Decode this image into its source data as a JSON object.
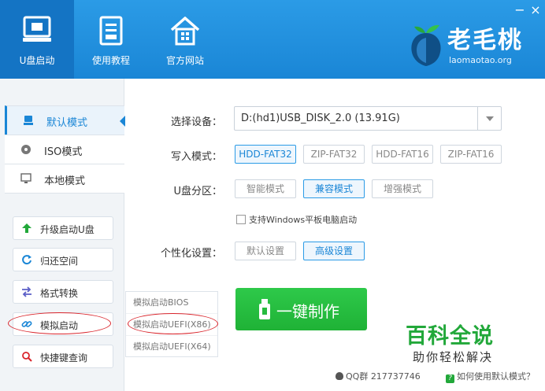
{
  "header": {
    "nav": [
      {
        "label": "U盘启动"
      },
      {
        "label": "使用教程"
      },
      {
        "label": "官方网站"
      }
    ],
    "window": {
      "minimize": "−",
      "close": "×"
    },
    "logo": {
      "title": "老毛桃",
      "site": "laomaotao.org"
    }
  },
  "sidebar": {
    "modes": [
      {
        "label": "默认模式"
      },
      {
        "label": "ISO模式"
      },
      {
        "label": "本地模式"
      }
    ],
    "tools": [
      {
        "label": "升级启动U盘"
      },
      {
        "label": "归还空间"
      },
      {
        "label": "格式转换"
      },
      {
        "label": "模拟启动"
      },
      {
        "label": "快捷键查询"
      }
    ]
  },
  "submenu": {
    "items": [
      "模拟启动BIOS",
      "模拟启动UEFI(X86)",
      "模拟启动UEFI(X64)"
    ]
  },
  "form": {
    "device_label": "选择设备：",
    "device_value": "D:(hd1)USB_DISK_2.0 (13.91G)",
    "write_label": "写入模式：",
    "write_options": [
      "HDD-FAT32",
      "ZIP-FAT32",
      "HDD-FAT16",
      "ZIP-FAT16"
    ],
    "partition_label": "U盘分区：",
    "partition_options": [
      "智能模式",
      "兼容模式",
      "增强模式"
    ],
    "tablet_checkbox": "支持Windows平板电脑启动",
    "personal_label": "个性化设置：",
    "personal_options": [
      "默认设置",
      "高级设置"
    ],
    "make_button": "一键制作"
  },
  "watermark": {
    "title": "百科全说",
    "subtitle": "助你轻松解决"
  },
  "footer": {
    "qq": "QQ群 217737746",
    "help": "如何使用默认模式？"
  },
  "colors": {
    "brand_blue": "#1a86d6",
    "green": "#22a83a",
    "highlight_red": "#d9242b"
  }
}
